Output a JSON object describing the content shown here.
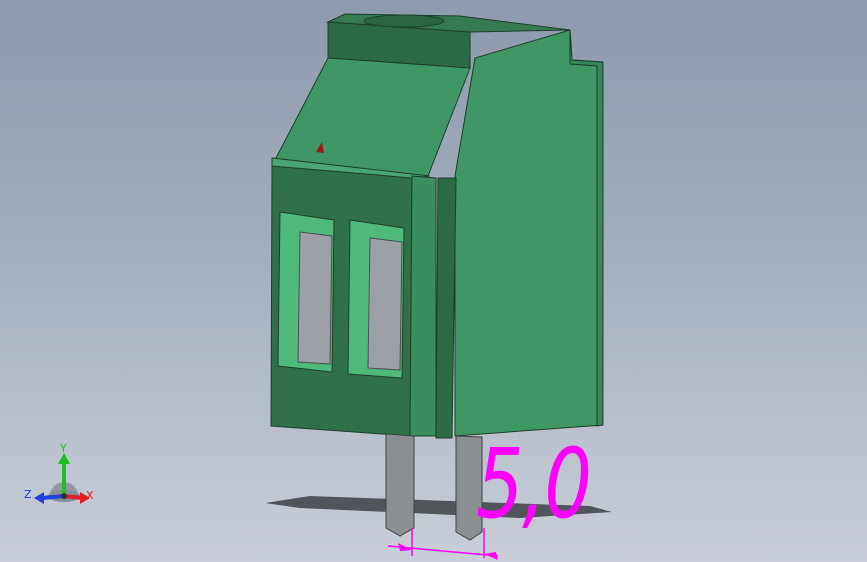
{
  "viewport": {
    "background_top": "#8d9aac",
    "background_bottom": "#c9ced8"
  },
  "model": {
    "body_color": "#3f9766",
    "dark_face_color": "#2c6a45",
    "light_face_color": "#4fb87b",
    "pin_color": "#8a8f92",
    "port_color": "#9aa0a5"
  },
  "annotation": {
    "dimension_text": "5,0",
    "color": "#ff00ff"
  },
  "triad": {
    "x_label": "X",
    "y_label": "Y",
    "z_label": "Z",
    "x_color": "#e02020",
    "y_color": "#20c020",
    "z_color": "#2040e0"
  }
}
